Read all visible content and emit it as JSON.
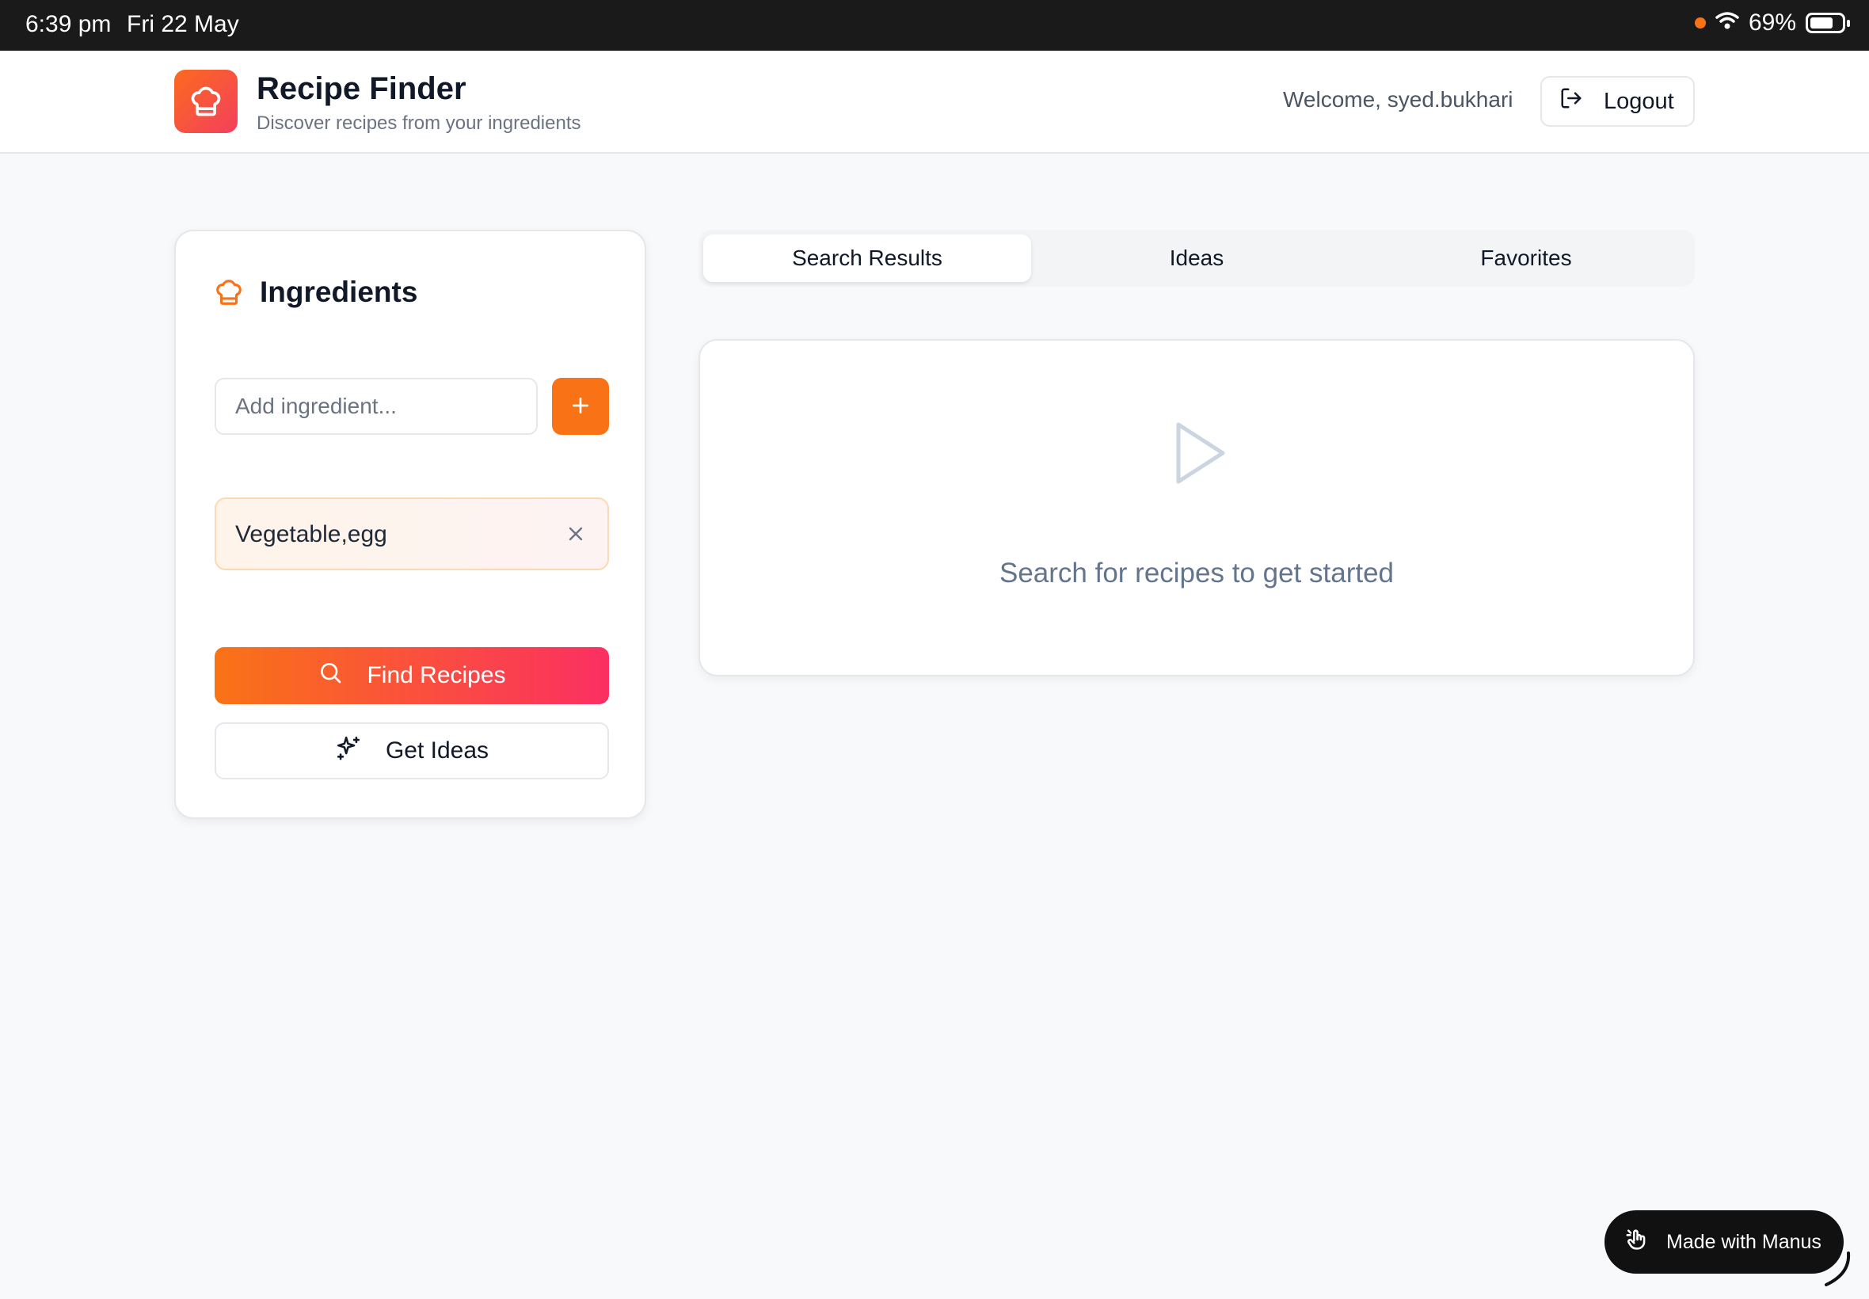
{
  "status_bar": {
    "time": "6:39 pm",
    "date": "Fri 22 May",
    "battery": "69%",
    "battery_level": 0.69,
    "icons": [
      "orange-dot-indicator",
      "wifi-icon",
      "battery-icon"
    ]
  },
  "header": {
    "title": "Recipe Finder",
    "subtitle": "Discover recipes from your ingredients",
    "welcome": "Welcome, syed.bukhari",
    "logout_label": "Logout",
    "logo_icon": "chef-hat-icon",
    "logout_icon": "logout-icon"
  },
  "ingredients_panel": {
    "title": "Ingredients",
    "title_icon": "chef-hat-icon",
    "input_placeholder": "Add ingredient...",
    "input_value": "",
    "add_button_icon": "plus-icon",
    "chips": [
      {
        "label": "Vegetable,egg",
        "remove_icon": "close-icon"
      }
    ],
    "find_button": {
      "label": "Find Recipes",
      "icon": "search-icon"
    },
    "ideas_button": {
      "label": "Get Ideas",
      "icon": "sparkles-icon"
    }
  },
  "tabs": [
    {
      "label": "Search Results",
      "active": true
    },
    {
      "label": "Ideas",
      "active": false
    },
    {
      "label": "Favorites",
      "active": false
    }
  ],
  "results": {
    "empty_message": "Search for recipes to get started",
    "empty_icon": "play-icon"
  },
  "badge": {
    "label": "Made with Manus",
    "icon": "manus-hand-icon"
  },
  "colors": {
    "accent": "#f97316",
    "accent_end": "#fb2f62",
    "text_primary": "#111827",
    "text_muted": "#6b7280",
    "border": "#e5e7eb",
    "status_bar": "#1a1a1a"
  }
}
